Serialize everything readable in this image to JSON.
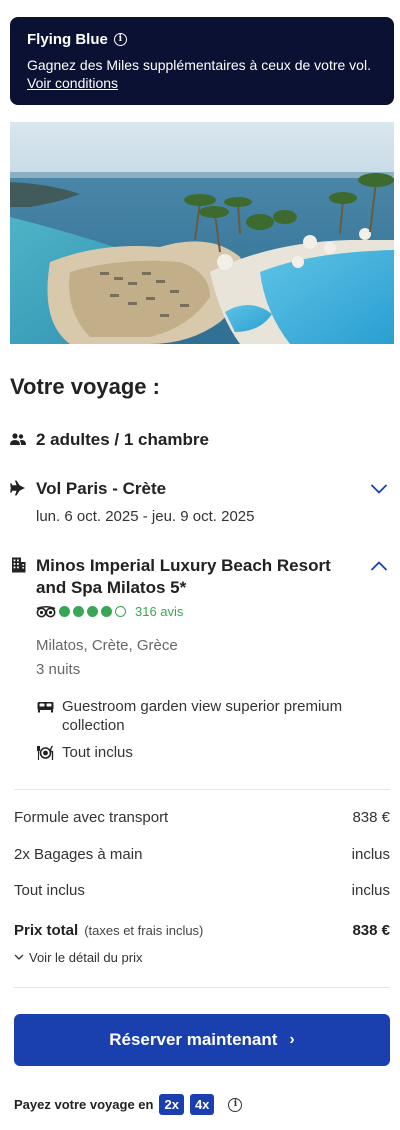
{
  "banner": {
    "title": "Flying Blue",
    "text": "Gagnez des Miles supplémentaires à ceux de votre vol.",
    "link": "Voir conditions",
    "bg_color": "#0a1133"
  },
  "hero": {
    "alt": "Resort pool and sea view"
  },
  "trip": {
    "title": "Votre voyage :",
    "travelers": "2 adultes / 1 chambre",
    "flight_title": "Vol Paris - Crète",
    "flight_dates": "lun. 6 oct. 2025 - jeu. 9 oct. 2025",
    "hotel_name": "Minos Imperial Luxury Beach Resort and Spa Milatos 5*",
    "rating_bubbles": 4,
    "rating_max": 5,
    "reviews": "316 avis",
    "location": "Milatos, Crète, Grèce",
    "nights": "3 nuits",
    "room": "Guestroom garden view superior premium collection",
    "board": "Tout inclus"
  },
  "pricing": {
    "rows": [
      {
        "label": "Formule avec transport",
        "value": "838 €"
      },
      {
        "label": "2x Bagages à main",
        "value": "inclus"
      },
      {
        "label": "Tout inclus",
        "value": "inclus"
      }
    ],
    "total_label": "Prix total",
    "total_note": "(taxes et frais inclus)",
    "total_value": "838 €",
    "detail_link": "Voir le détail du prix"
  },
  "cta": {
    "label": "Réserver maintenant",
    "color": "#1a3fae"
  },
  "installments": {
    "label": "Payez votre voyage en",
    "options": [
      "2x",
      "4x"
    ]
  },
  "colors": {
    "rating_green": "#3aa655",
    "link_blue": "#1a3fae"
  }
}
